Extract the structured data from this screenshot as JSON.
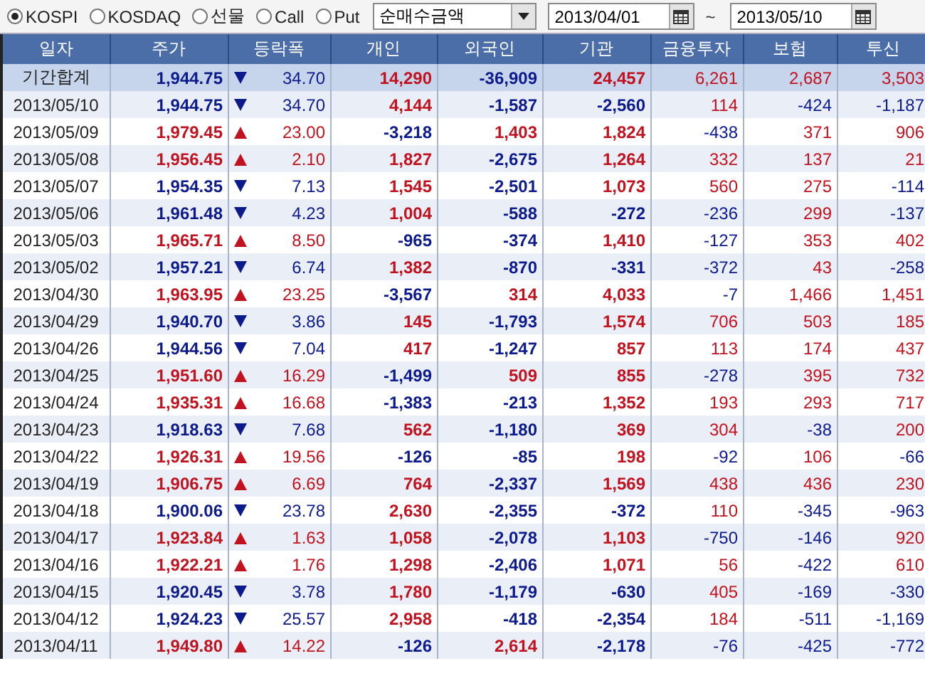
{
  "toolbar": {
    "markets": [
      {
        "label": "KOSPI",
        "selected": true
      },
      {
        "label": "KOSDAQ",
        "selected": false
      },
      {
        "label": "선물",
        "selected": false
      },
      {
        "label": "Call",
        "selected": false
      },
      {
        "label": "Put",
        "selected": false
      }
    ],
    "metric_dropdown": {
      "value": "순매수금액"
    },
    "start_date": {
      "value": "2013/04/01"
    },
    "range_separator": "~",
    "end_date": {
      "value": "2013/05/10"
    }
  },
  "table": {
    "columns": [
      "일자",
      "주가",
      "등락폭",
      "개인",
      "외국인",
      "기관",
      "금융투자",
      "보험",
      "투신"
    ],
    "total_row": {
      "rising": false,
      "cells": [
        "기간합계",
        "1,944.75",
        "34.70",
        "14,290",
        "-36,909",
        "24,457",
        "6,261",
        "2,687",
        "3,503"
      ]
    },
    "rows": [
      {
        "rising": false,
        "cells": [
          "2013/05/10",
          "1,944.75",
          "34.70",
          "4,144",
          "-1,587",
          "-2,560",
          "114",
          "-424",
          "-1,187"
        ]
      },
      {
        "rising": true,
        "cells": [
          "2013/05/09",
          "1,979.45",
          "23.00",
          "-3,218",
          "1,403",
          "1,824",
          "-438",
          "371",
          "906"
        ]
      },
      {
        "rising": true,
        "cells": [
          "2013/05/08",
          "1,956.45",
          "2.10",
          "1,827",
          "-2,675",
          "1,264",
          "332",
          "137",
          "21"
        ]
      },
      {
        "rising": false,
        "cells": [
          "2013/05/07",
          "1,954.35",
          "7.13",
          "1,545",
          "-2,501",
          "1,073",
          "560",
          "275",
          "-114"
        ]
      },
      {
        "rising": false,
        "cells": [
          "2013/05/06",
          "1,961.48",
          "4.23",
          "1,004",
          "-588",
          "-272",
          "-236",
          "299",
          "-137"
        ]
      },
      {
        "rising": true,
        "cells": [
          "2013/05/03",
          "1,965.71",
          "8.50",
          "-965",
          "-374",
          "1,410",
          "-127",
          "353",
          "402"
        ]
      },
      {
        "rising": false,
        "cells": [
          "2013/05/02",
          "1,957.21",
          "6.74",
          "1,382",
          "-870",
          "-331",
          "-372",
          "43",
          "-258"
        ]
      },
      {
        "rising": true,
        "cells": [
          "2013/04/30",
          "1,963.95",
          "23.25",
          "-3,567",
          "314",
          "4,033",
          "-7",
          "1,466",
          "1,451"
        ]
      },
      {
        "rising": false,
        "cells": [
          "2013/04/29",
          "1,940.70",
          "3.86",
          "145",
          "-1,793",
          "1,574",
          "706",
          "503",
          "185"
        ]
      },
      {
        "rising": false,
        "cells": [
          "2013/04/26",
          "1,944.56",
          "7.04",
          "417",
          "-1,247",
          "857",
          "113",
          "174",
          "437"
        ]
      },
      {
        "rising": true,
        "cells": [
          "2013/04/25",
          "1,951.60",
          "16.29",
          "-1,499",
          "509",
          "855",
          "-278",
          "395",
          "732"
        ]
      },
      {
        "rising": true,
        "cells": [
          "2013/04/24",
          "1,935.31",
          "16.68",
          "-1,383",
          "-213",
          "1,352",
          "193",
          "293",
          "717"
        ]
      },
      {
        "rising": false,
        "cells": [
          "2013/04/23",
          "1,918.63",
          "7.68",
          "562",
          "-1,180",
          "369",
          "304",
          "-38",
          "200"
        ]
      },
      {
        "rising": true,
        "cells": [
          "2013/04/22",
          "1,926.31",
          "19.56",
          "-126",
          "-85",
          "198",
          "-92",
          "106",
          "-66"
        ]
      },
      {
        "rising": true,
        "cells": [
          "2013/04/19",
          "1,906.75",
          "6.69",
          "764",
          "-2,337",
          "1,569",
          "438",
          "436",
          "230"
        ]
      },
      {
        "rising": false,
        "cells": [
          "2013/04/18",
          "1,900.06",
          "23.78",
          "2,630",
          "-2,355",
          "-372",
          "110",
          "-345",
          "-963"
        ]
      },
      {
        "rising": true,
        "cells": [
          "2013/04/17",
          "1,923.84",
          "1.63",
          "1,058",
          "-2,078",
          "1,103",
          "-750",
          "-146",
          "920"
        ]
      },
      {
        "rising": true,
        "cells": [
          "2013/04/16",
          "1,922.21",
          "1.76",
          "1,298",
          "-2,406",
          "1,071",
          "56",
          "-422",
          "610"
        ]
      },
      {
        "rising": false,
        "cells": [
          "2013/04/15",
          "1,920.45",
          "3.78",
          "1,780",
          "-1,179",
          "-630",
          "405",
          "-169",
          "-330"
        ]
      },
      {
        "rising": false,
        "cells": [
          "2013/04/12",
          "1,924.23",
          "25.57",
          "2,958",
          "-418",
          "-2,354",
          "184",
          "-511",
          "-1,169"
        ]
      },
      {
        "rising": true,
        "cells": [
          "2013/04/11",
          "1,949.80",
          "14.22",
          "-126",
          "2,614",
          "-2,178",
          "-76",
          "-425",
          "-772"
        ]
      }
    ]
  }
}
